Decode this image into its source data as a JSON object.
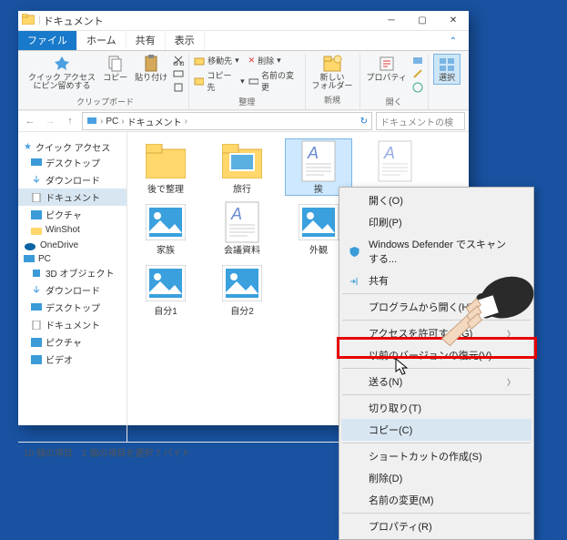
{
  "window": {
    "title": "ドキュメント",
    "tabs": {
      "file": "ファイル",
      "home": "ホーム",
      "share": "共有",
      "view": "表示"
    }
  },
  "ribbon": {
    "pin": "クイック アクセス\nにピン留めする",
    "copy": "コピー",
    "paste": "貼り付け",
    "clipboard_group": "クリップボード",
    "move_to": "移動先",
    "copy_to": "コピー先",
    "delete": "削除",
    "rename": "名前の変更",
    "organize_group": "整理",
    "new_folder": "新しい\nフォルダー",
    "new_group": "新規",
    "properties": "プロパティ",
    "open_group": "開く",
    "select": "選択"
  },
  "address": {
    "pc": "PC",
    "doc": "ドキュメント",
    "search_placeholder": "ドキュメントの検"
  },
  "sidebar": {
    "quick": "クイック アクセス",
    "desktop": "デスクトップ",
    "downloads": "ダウンロード",
    "documents": "ドキュメント",
    "pictures": "ピクチャ",
    "winshot": "WinShot",
    "onedrive": "OneDrive",
    "pc": "PC",
    "objects3d": "3D オブジェクト",
    "downloads2": "ダウンロード",
    "desktop2": "デスクトップ",
    "documents2": "ドキュメント",
    "pictures2": "ピクチャ",
    "videos": "ビデオ"
  },
  "files": {
    "f0": "後で整理",
    "f1": "旅行",
    "f2": "挨",
    "f3": "家族",
    "f4": "会議資料",
    "f5": "外観",
    "f6": "自分1",
    "f7": "自分2"
  },
  "status": {
    "count": "10 個の項目",
    "sel": "1 個の項目を選択 7 バイト"
  },
  "ctx": {
    "open": "開く(O)",
    "print": "印刷(P)",
    "defender": "Windows Defender でスキャンする...",
    "share": "共有",
    "open_with": "プログラムから開く(H)...",
    "access": "アクセスを許可する(G)",
    "restore": "以前のバージョンの復元(V)",
    "send": "送る(N)",
    "cut": "切り取り(T)",
    "copy": "コピー(C)",
    "shortcut": "ショートカットの作成(S)",
    "delete": "削除(D)",
    "rename": "名前の変更(M)",
    "props": "プロパティ(R)"
  }
}
